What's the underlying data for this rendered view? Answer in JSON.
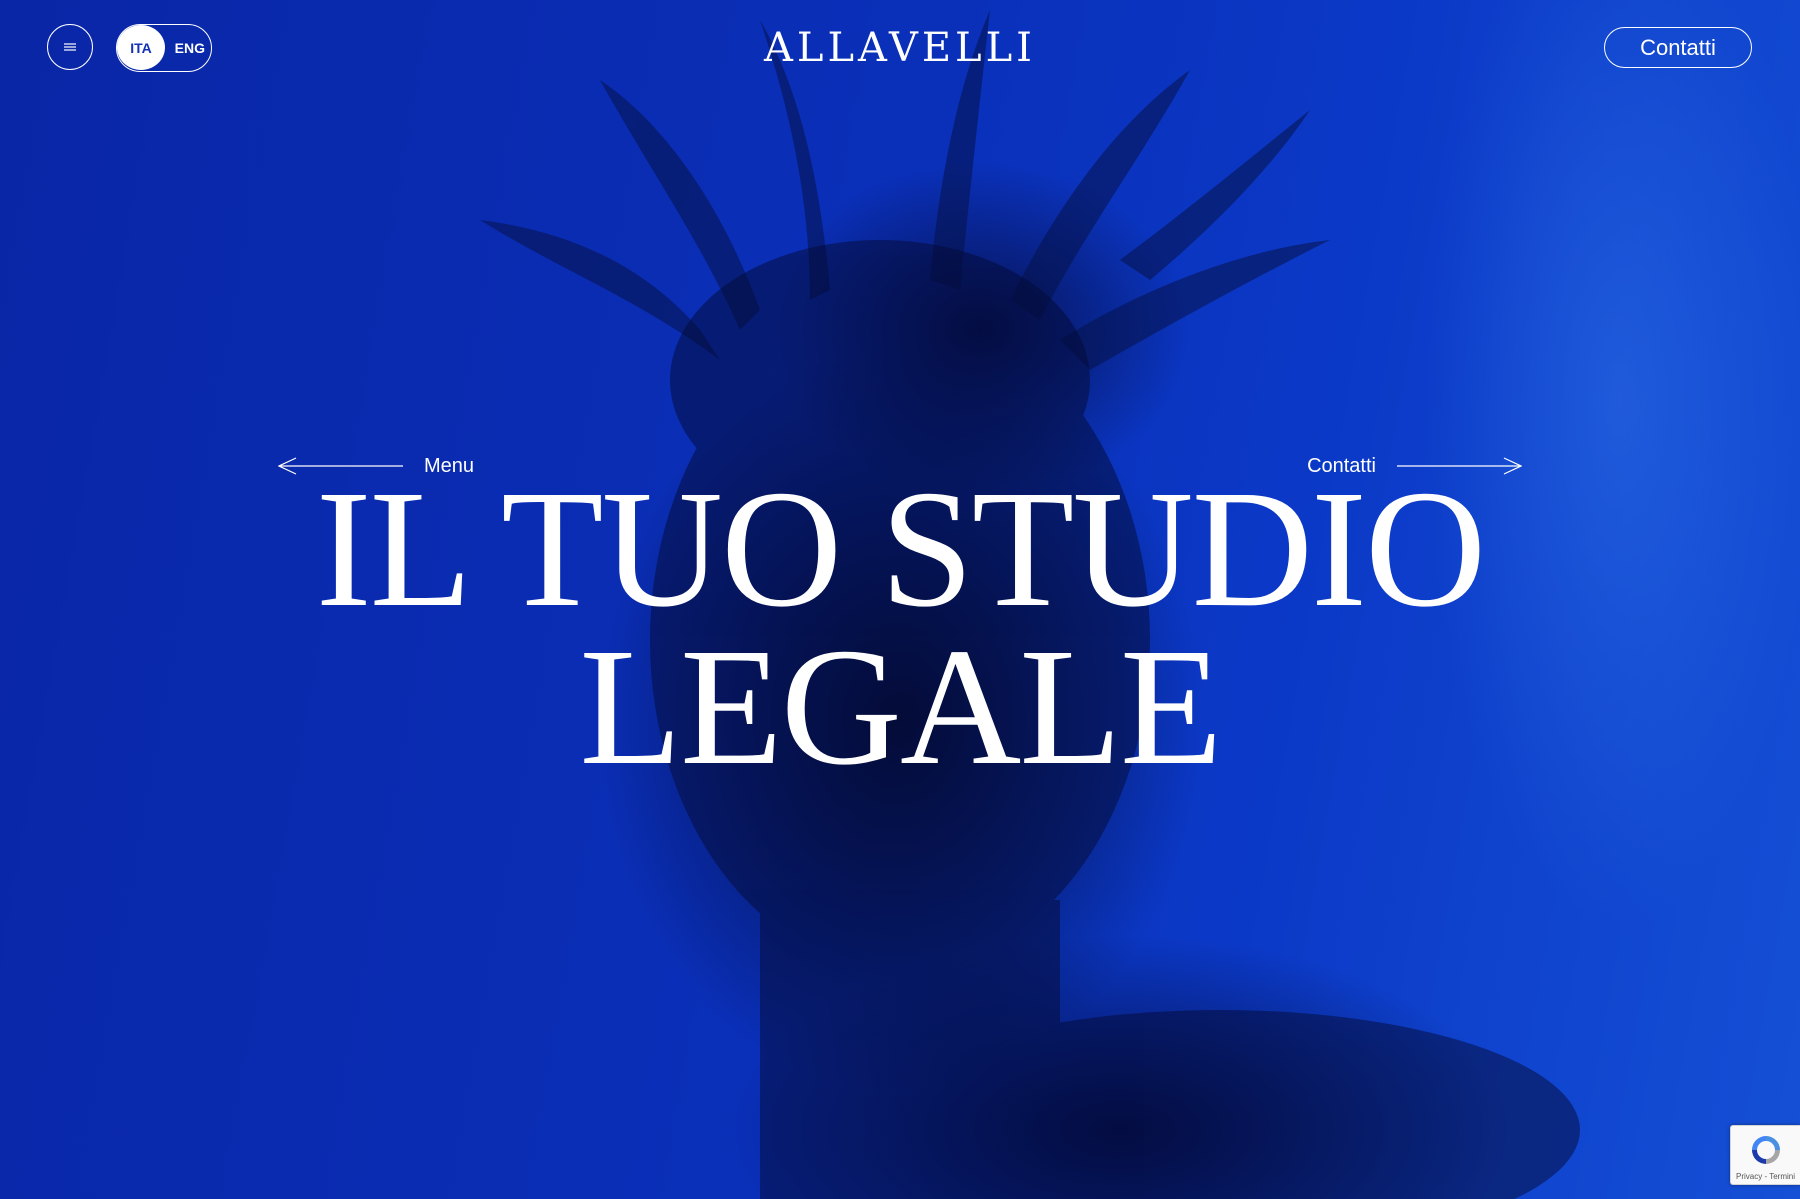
{
  "brand": {
    "logo_text": "ALLAVELLI"
  },
  "header": {
    "menu_icon": "hamburger-icon",
    "languages": {
      "active": "ITA",
      "inactive": "ENG"
    },
    "contact_label": "Contatti"
  },
  "hero": {
    "nav_left_label": "Menu",
    "nav_left_icon": "arrow-left-icon",
    "nav_right_label": "Contatti",
    "nav_right_icon": "arrow-right-icon",
    "headline_line1": "IL TUO STUDIO",
    "headline_line2": "LEGALE"
  },
  "recaptcha": {
    "icon": "recaptcha-icon",
    "privacy_label": "Privacy",
    "separator": "-",
    "terms_label": "Termini"
  },
  "colors": {
    "background": "#0a2fb8",
    "text": "#ffffff",
    "toggle_active_text": "#1431b5"
  }
}
